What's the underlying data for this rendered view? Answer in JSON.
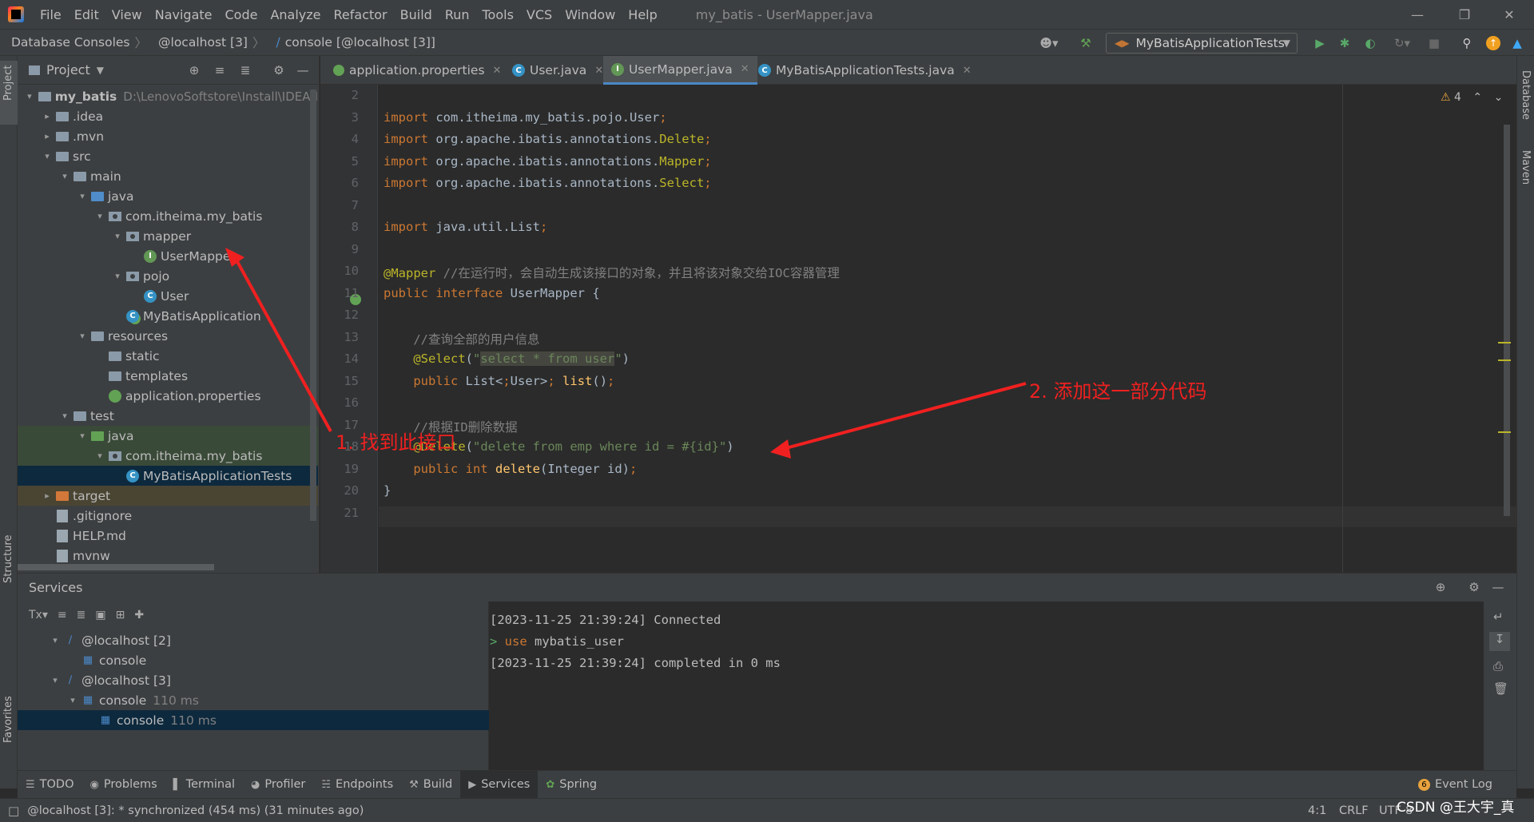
{
  "menubar": {
    "items": [
      "File",
      "Edit",
      "View",
      "Navigate",
      "Code",
      "Analyze",
      "Refactor",
      "Build",
      "Run",
      "Tools",
      "VCS",
      "Window",
      "Help"
    ],
    "title": "my_batis - UserMapper.java"
  },
  "navbar": {
    "crumbs": [
      "Database Consoles",
      "@localhost [3]",
      "console [@localhost [3]]"
    ],
    "run_config": "MyBatisApplicationTests"
  },
  "left_strip": {
    "project": "Project",
    "structure": "Structure",
    "favorites": "Favorites"
  },
  "right_strip": {
    "database": "Database",
    "maven": "Maven"
  },
  "project": {
    "title": "Project",
    "tree": [
      {
        "label": "my_batis",
        "sub": "D:\\LenovoSoftstore\\Install\\IDEA\\I",
        "icon": "folder",
        "arrow": "down"
      },
      {
        "label": ".idea",
        "icon": "folder",
        "arrow": "right"
      },
      {
        "label": ".mvn",
        "icon": "folder",
        "arrow": "right"
      },
      {
        "label": "src",
        "icon": "folder",
        "arrow": "down"
      },
      {
        "label": "main",
        "icon": "folder",
        "arrow": "down"
      },
      {
        "label": "java",
        "icon": "folder-blue",
        "arrow": "down"
      },
      {
        "label": "com.itheima.my_batis",
        "icon": "package",
        "arrow": "down"
      },
      {
        "label": "mapper",
        "icon": "package",
        "arrow": "down"
      },
      {
        "label": "UserMapper",
        "icon": "interface",
        "arrow": ""
      },
      {
        "label": "pojo",
        "icon": "package",
        "arrow": "down"
      },
      {
        "label": "User",
        "icon": "class",
        "arrow": ""
      },
      {
        "label": "MyBatisApplication",
        "icon": "spring-class",
        "arrow": ""
      },
      {
        "label": "resources",
        "icon": "folder",
        "arrow": "down"
      },
      {
        "label": "static",
        "icon": "folder",
        "arrow": ""
      },
      {
        "label": "templates",
        "icon": "folder",
        "arrow": ""
      },
      {
        "label": "application.properties",
        "icon": "spring-file",
        "arrow": ""
      },
      {
        "label": "test",
        "icon": "folder",
        "arrow": "down"
      },
      {
        "label": "java",
        "icon": "folder-green",
        "arrow": "down"
      },
      {
        "label": "com.itheima.my_batis",
        "icon": "package",
        "arrow": "down"
      },
      {
        "label": "MyBatisApplicationTests",
        "icon": "class",
        "arrow": ""
      },
      {
        "label": "target",
        "icon": "folder-orange",
        "arrow": "right"
      },
      {
        "label": ".gitignore",
        "icon": "file",
        "arrow": ""
      },
      {
        "label": "HELP.md",
        "icon": "file",
        "arrow": ""
      },
      {
        "label": "mvnw",
        "icon": "file",
        "arrow": ""
      }
    ]
  },
  "editor": {
    "tabs": [
      "application.properties",
      "User.java",
      "UserMapper.java",
      "MyBatisApplicationTests.java"
    ],
    "active_tab": "UserMapper.java",
    "warnings": "4",
    "lines": [
      {
        "n": "2",
        "t": ""
      },
      {
        "n": "3",
        "t": "import com.itheima.my_batis.pojo.User;"
      },
      {
        "n": "4",
        "t": "import org.apache.ibatis.annotations.Delete;"
      },
      {
        "n": "5",
        "t": "import org.apache.ibatis.annotations.Mapper;"
      },
      {
        "n": "6",
        "t": "import org.apache.ibatis.annotations.Select;"
      },
      {
        "n": "7",
        "t": ""
      },
      {
        "n": "8",
        "t": "import java.util.List;"
      },
      {
        "n": "9",
        "t": ""
      },
      {
        "n": "10",
        "t": "@Mapper //在运行时，会自动生成该接口的对象，并且将该对象交给IOC容器管理"
      },
      {
        "n": "11",
        "t": "public interface UserMapper {"
      },
      {
        "n": "12",
        "t": ""
      },
      {
        "n": "13",
        "t": "    //查询全部的用户信息"
      },
      {
        "n": "14",
        "t": "    @Select(\"select * from user\")"
      },
      {
        "n": "15",
        "t": "    public List<User> list();"
      },
      {
        "n": "16",
        "t": ""
      },
      {
        "n": "17",
        "t": "    //根据ID删除数据"
      },
      {
        "n": "18",
        "t": "    @Delete(\"delete from emp where id = #{id}\")"
      },
      {
        "n": "19",
        "t": "    public int delete(Integer id);"
      },
      {
        "n": "20",
        "t": "}"
      },
      {
        "n": "21",
        "t": ""
      }
    ]
  },
  "services": {
    "title": "Services",
    "tree": [
      {
        "label": "@localhost [2]",
        "sub": "",
        "arrow": "down"
      },
      {
        "label": "console",
        "sub": "",
        "arrow": ""
      },
      {
        "label": "@localhost [3]",
        "sub": "",
        "arrow": "down"
      },
      {
        "label": "console",
        "sub": "110 ms",
        "arrow": "down"
      },
      {
        "label": "console",
        "sub": "110 ms",
        "arrow": ""
      }
    ],
    "console": [
      "[2023-11-25 21:39:24] Connected",
      "use mybatis_user",
      "[2023-11-25 21:39:24] completed in 0 ms"
    ]
  },
  "bottom_tabs": [
    "TODO",
    "Problems",
    "Terminal",
    "Profiler",
    "Endpoints",
    "Build",
    "Services",
    "Spring"
  ],
  "event_log": {
    "count": "6",
    "label": "Event Log"
  },
  "status": {
    "message": "@localhost [3]: * synchronized (454 ms) (31 minutes ago)",
    "position": "4:1",
    "line_sep": "CRLF",
    "encoding": "UTF-8"
  },
  "annotations": {
    "step1": "1. 找到此接口",
    "step2": "2. 添加这一部分代码",
    "color": "#f02020"
  },
  "watermark": "CSDN @王大宇_真"
}
